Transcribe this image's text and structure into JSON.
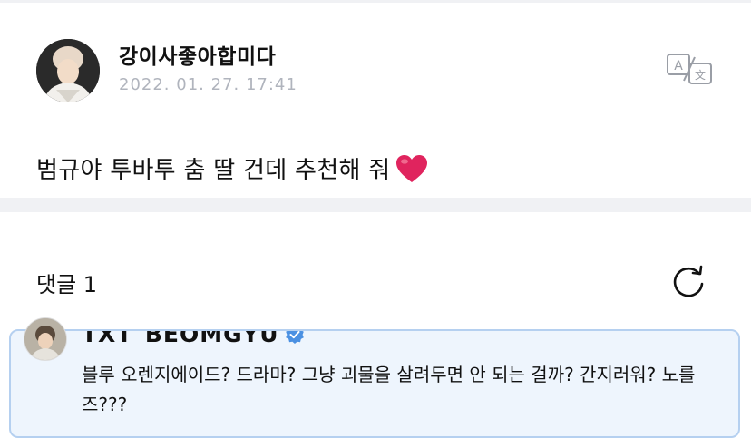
{
  "post": {
    "author": "강이사좋아합미다",
    "timestamp": "2022. 01. 27. 17:41",
    "text": "범규야 투바투 춤 딸 건데 추천해 줘",
    "translate_icon": "translate-icon",
    "emoji": "red-heart"
  },
  "comments": {
    "label": "댓글 1",
    "refresh_icon": "refresh-icon",
    "items": [
      {
        "author": "TXT_BEOMGYU",
        "verified": true,
        "text": "블루 오렌지에이드? 드라마? 그냥 괴물을 살려두면 안 되는 걸까? 간지러워? 노를즈???"
      }
    ]
  },
  "colors": {
    "separator": "#f0f1f4",
    "timestamp": "#b0b4bd",
    "highlight_bg": "#eef5fd",
    "highlight_border": "#b5d0f0",
    "verified": "#4a90e2",
    "heart": "#e0245e"
  }
}
